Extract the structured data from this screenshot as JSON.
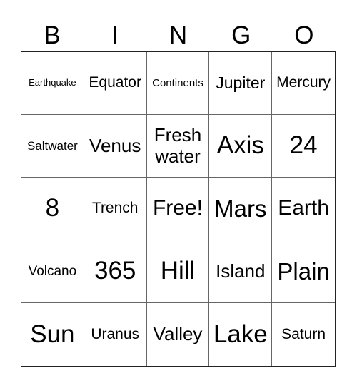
{
  "header": [
    "B",
    "I",
    "N",
    "G",
    "O"
  ],
  "cells": [
    [
      "Earthquake",
      "Equator",
      "Continents",
      "Jupiter",
      "Mercury"
    ],
    [
      "Saltwater",
      "Venus",
      "Fresh water",
      "Axis",
      "24"
    ],
    [
      "8",
      "Trench",
      "Free!",
      "Mars",
      "Earth"
    ],
    [
      "Volcano",
      "365",
      "Hill",
      "Island",
      "Plain"
    ],
    [
      "Sun",
      "Uranus",
      "Valley",
      "Lake",
      "Saturn"
    ]
  ]
}
